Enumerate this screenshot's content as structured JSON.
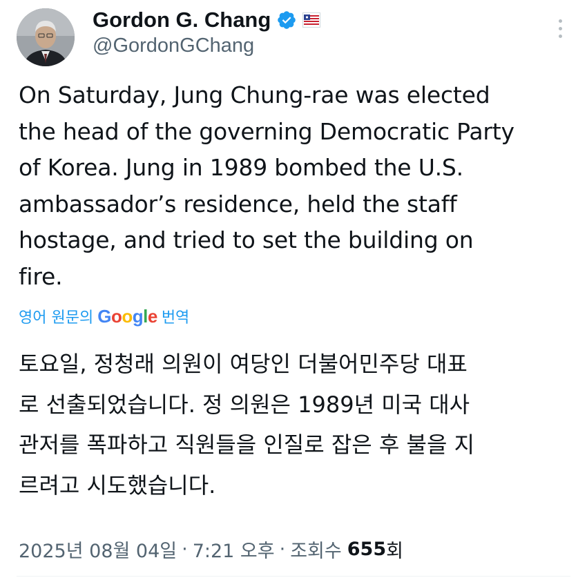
{
  "author": {
    "display_name": "Gordon G. Chang",
    "handle": "@GordonGChang",
    "verified_icon": "verified-badge-icon",
    "affiliation_icon": "flag-badge-icon"
  },
  "tweet": {
    "text_lines": [
      "On Saturday, Jung Chung-rae was elected",
      "the head of the governing Democratic Party",
      "of Korea. Jung in 1989 bombed the U.S.",
      "ambassador’s residence, held the staff",
      "hostage, and tried to set the building on",
      "fire."
    ]
  },
  "translation": {
    "prefix": "영어 원문의",
    "google": [
      "G",
      "o",
      "o",
      "g",
      "l",
      "e"
    ],
    "google_colors": [
      "#4285f4",
      "#ea4335",
      "#fbbc05",
      "#4285f4",
      "#34a853",
      "#ea4335"
    ],
    "suffix": "번역",
    "text_lines": [
      "토요일, 정청래 의원이 여당인 더불어민주당 대표",
      "로 선출되었습니다. 정 의원은 1989년 미국 대사",
      "관저를 폭파하고 직원들을 인질로 잡은 후 불을 지",
      "르려고 시도했습니다."
    ]
  },
  "meta": {
    "date": "2025년 08월 04일",
    "separator": "·",
    "time": "7:21 오후",
    "views_label": "조회수",
    "views_count": "655",
    "views_suffix": "회"
  },
  "colors": {
    "link": "#1d9bf0",
    "secondary_text": "#536471",
    "primary_text": "#0f1419"
  }
}
